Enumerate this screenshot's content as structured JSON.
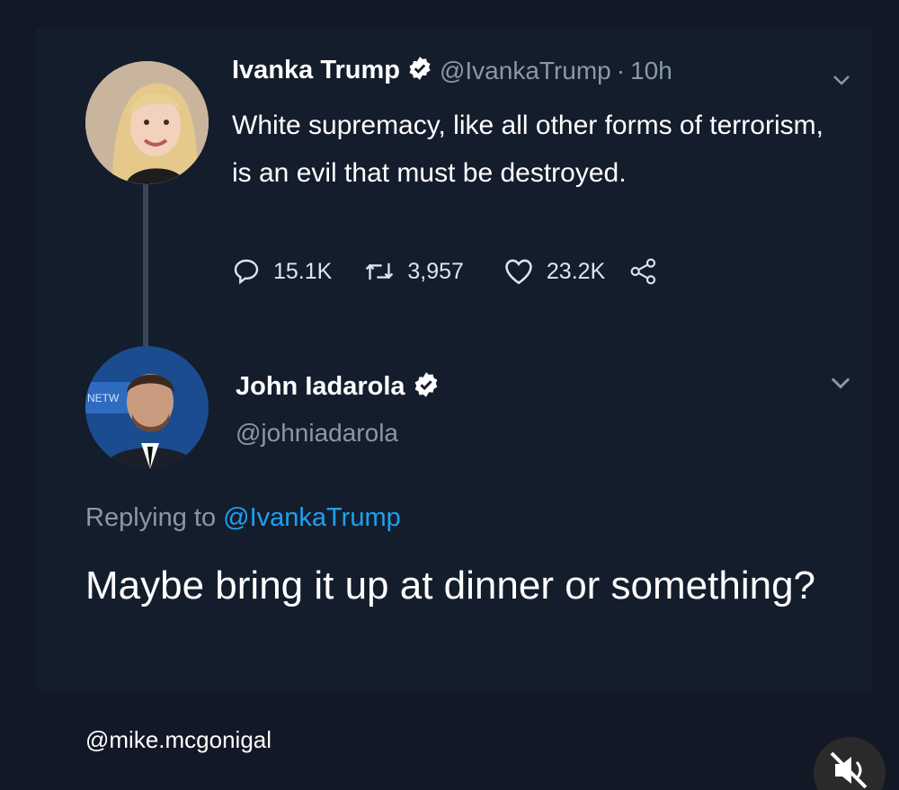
{
  "original_tweet": {
    "author_name": "Ivanka Trump",
    "handle": "@IvankaTrump",
    "separator": "·",
    "time": "10h",
    "text": "White supremacy, like all other forms of terrorism, is an evil that must be destroyed.",
    "stats": {
      "replies": "15.1K",
      "retweets": "3,957",
      "likes": "23.2K"
    },
    "icons": [
      "verified-badge-icon",
      "chevron-down-icon",
      "reply-icon",
      "retweet-icon",
      "heart-icon",
      "share-icon"
    ]
  },
  "reply_tweet": {
    "author_name": "John Iadarola",
    "handle": "@johniadarola",
    "replying_prefix": "Replying to",
    "replying_to": "@IvankaTrump",
    "text": "Maybe bring it up at dinner or something?",
    "icons": [
      "verified-badge-icon",
      "chevron-down-icon"
    ]
  },
  "watermark": "@mike.mcgonigal",
  "colors": {
    "background": "#121826",
    "card": "#141d2c",
    "text": "#ffffff",
    "muted": "#8899a6",
    "link": "#1da1f2",
    "thread_line": "#3b4656"
  }
}
